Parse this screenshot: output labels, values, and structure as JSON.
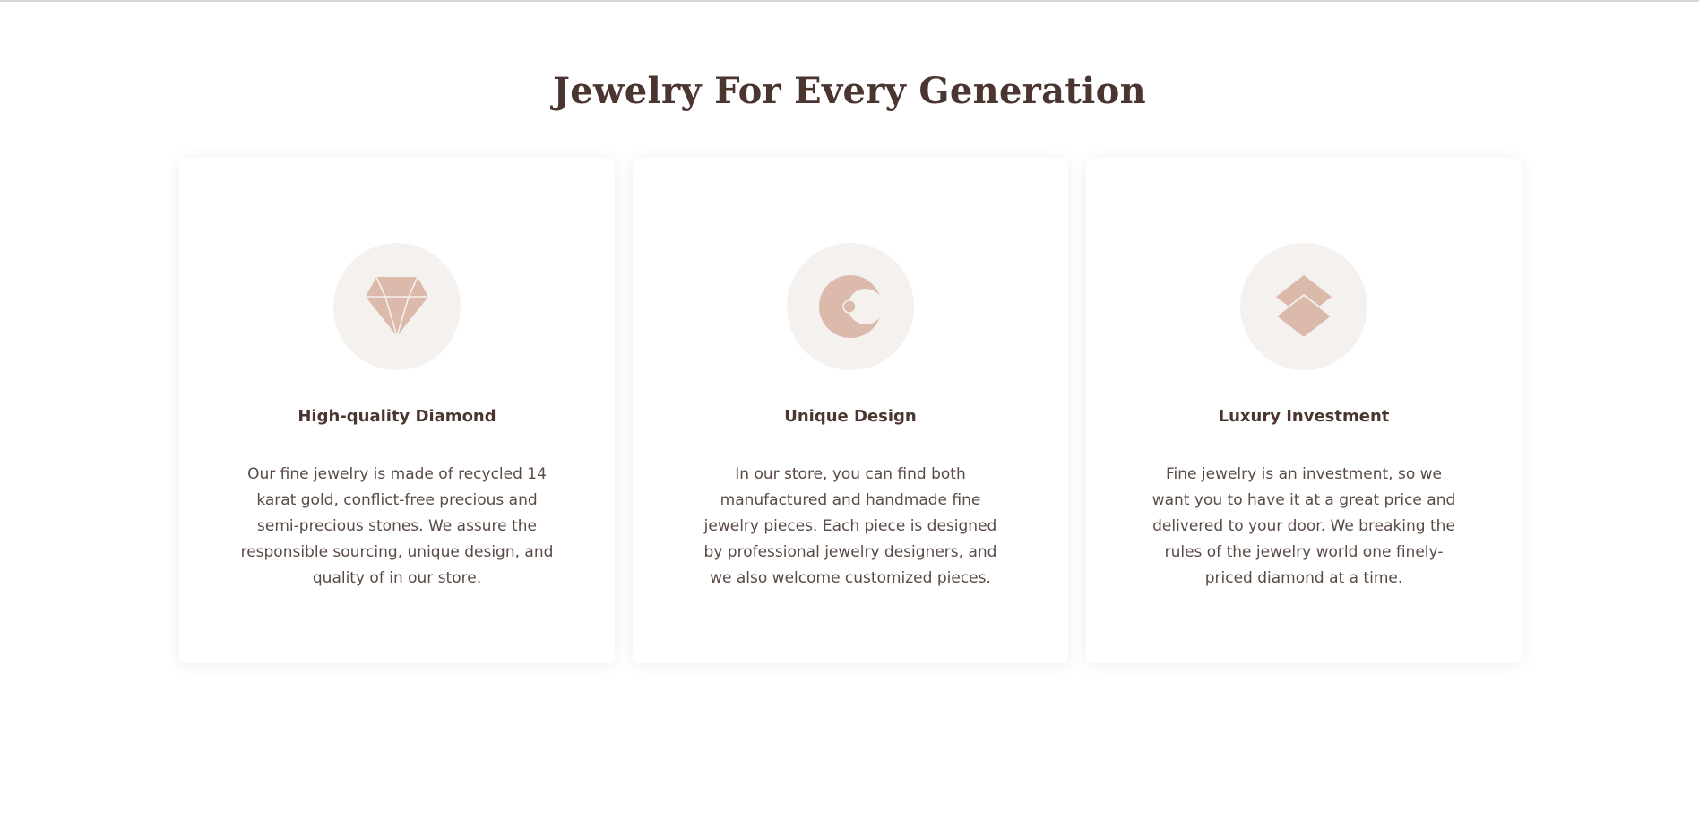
{
  "section": {
    "title": "Jewelry For Every Generation"
  },
  "features": [
    {
      "icon": "diamond-icon",
      "title": "High-quality Diamond",
      "text": "Our fine jewelry is made of recycled 14 karat gold, conflict-free precious and semi-precious stones. We assure the responsible sourcing, unique design, and quality of in our store."
    },
    {
      "icon": "crescent-moon-icon",
      "title": "Unique Design",
      "text": "In our store, you can find both manufactured and handmade fine jewelry pieces. Each piece is designed by professional jewelry designers, and we also welcome customized pieces."
    },
    {
      "icon": "layers-icon",
      "title": "Luxury Investment",
      "text": "Fine jewelry is an investment, so we want you to have it at a great price and delivered to your door. We breaking the rules of the jewelry world one finely-priced diamond at a time."
    }
  ],
  "colors": {
    "accent": "#dbb9ab",
    "icon_background": "#f5f1ee",
    "heading": "#4a3531",
    "body_text": "#5a4a44"
  }
}
